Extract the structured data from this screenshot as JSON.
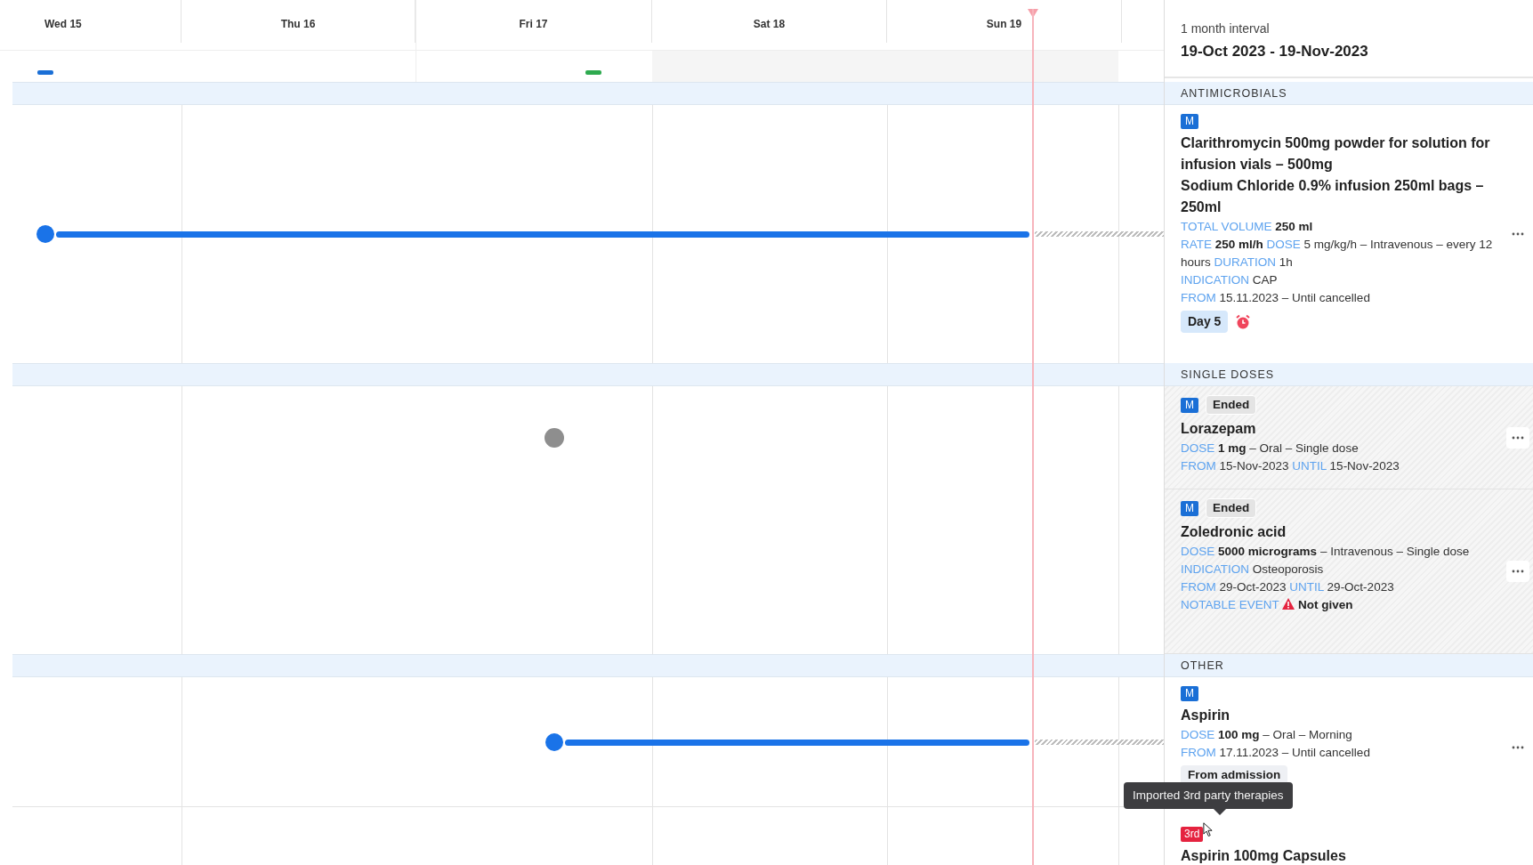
{
  "timeline": {
    "days": [
      {
        "label": "Wed 15"
      },
      {
        "label": "Thu 16"
      },
      {
        "label": "Fri 17"
      },
      {
        "label": "Sat 18"
      },
      {
        "label": "Sun 19"
      }
    ],
    "markers": [
      {
        "color": "#1a6fd6"
      },
      {
        "color": "#2eaa4f"
      }
    ],
    "rows": [
      {
        "kind": "course",
        "ongoing": true
      },
      {
        "kind": "single",
        "ongoing": false
      },
      {
        "kind": "course",
        "ongoing": true
      }
    ]
  },
  "panel": {
    "interval": "1 month interval",
    "range": "19-Oct 2023 - 19-Nov-2023",
    "sections": [
      {
        "title": "ANTIMICROBIALS",
        "items": [
          {
            "ended": false,
            "badges": [
              {
                "kind": "m",
                "text": "M"
              }
            ],
            "names": [
              "Clarithromycin 500mg powder for solution for infusion vials – 500mg",
              "Sodium Chloride 0.9% infusion 250ml bags – 250ml"
            ],
            "details": [
              [
                {
                  "kind": "label",
                  "text": "TOTAL VOLUME"
                },
                {
                  "kind": "strong",
                  "text": "250 ml"
                }
              ],
              [
                {
                  "kind": "label",
                  "text": "RATE"
                },
                {
                  "kind": "strong",
                  "text": "250 ml/h"
                },
                {
                  "kind": "label",
                  "text": "DOSE"
                },
                {
                  "kind": "text",
                  "text": "5 mg/kg/h – Intravenous – every 12 hours"
                },
                {
                  "kind": "label",
                  "text": "DURATION"
                },
                {
                  "kind": "text",
                  "text": "1h"
                }
              ],
              [
                {
                  "kind": "label",
                  "text": "INDICATION"
                },
                {
                  "kind": "text",
                  "text": "CAP"
                }
              ],
              [
                {
                  "kind": "label",
                  "text": "FROM"
                },
                {
                  "kind": "text",
                  "text": "15.11.2023 – Until cancelled"
                }
              ]
            ],
            "tags": [
              {
                "kind": "day",
                "text": "Day 5"
              },
              {
                "kind": "alarm"
              }
            ]
          }
        ]
      },
      {
        "title": "SINGLE DOSES",
        "items": [
          {
            "ended": true,
            "badges": [
              {
                "kind": "m",
                "text": "M"
              },
              {
                "kind": "status",
                "text": "Ended"
              }
            ],
            "names": [
              "Lorazepam"
            ],
            "details": [
              [
                {
                  "kind": "label",
                  "text": "DOSE"
                },
                {
                  "kind": "strong",
                  "text": "1 mg"
                },
                {
                  "kind": "text",
                  "text": "– Oral – Single dose"
                }
              ],
              [
                {
                  "kind": "label",
                  "text": "FROM"
                },
                {
                  "kind": "text",
                  "text": "15-Nov-2023"
                },
                {
                  "kind": "label",
                  "text": "UNTIL"
                },
                {
                  "kind": "text",
                  "text": "15-Nov-2023"
                }
              ]
            ]
          },
          {
            "ended": true,
            "badges": [
              {
                "kind": "m",
                "text": "M"
              },
              {
                "kind": "status",
                "text": "Ended"
              }
            ],
            "names": [
              "Zoledronic acid"
            ],
            "details": [
              [
                {
                  "kind": "label",
                  "text": "DOSE"
                },
                {
                  "kind": "strong",
                  "text": "5000 micrograms"
                },
                {
                  "kind": "text",
                  "text": "– Intravenous – Single dose"
                }
              ],
              [
                {
                  "kind": "label",
                  "text": "INDICATION"
                },
                {
                  "kind": "text",
                  "text": "Osteoporosis"
                }
              ],
              [
                {
                  "kind": "label",
                  "text": "FROM"
                },
                {
                  "kind": "text",
                  "text": "29-Oct-2023"
                },
                {
                  "kind": "label",
                  "text": "UNTIL"
                },
                {
                  "kind": "text",
                  "text": "29-Oct-2023"
                }
              ],
              [
                {
                  "kind": "label",
                  "text": "NOTABLE EVENT"
                },
                {
                  "kind": "warning"
                },
                {
                  "kind": "strong",
                  "text": "Not given"
                }
              ]
            ]
          }
        ]
      },
      {
        "title": "OTHER",
        "items": [
          {
            "ended": false,
            "badges": [
              {
                "kind": "m",
                "text": "M"
              }
            ],
            "names": [
              "Aspirin"
            ],
            "details": [
              [
                {
                  "kind": "label",
                  "text": "DOSE"
                },
                {
                  "kind": "strong",
                  "text": "100 mg"
                },
                {
                  "kind": "text",
                  "text": "– Oral – Morning"
                }
              ],
              [
                {
                  "kind": "label",
                  "text": "FROM"
                },
                {
                  "kind": "text",
                  "text": "17.11.2023 – Until cancelled"
                }
              ]
            ],
            "tags": [
              {
                "kind": "plain",
                "text": "From admission"
              }
            ]
          },
          {
            "ended": false,
            "badges": [
              {
                "kind": "third",
                "text": "3rd"
              }
            ],
            "names": [
              "Aspirin 100mg Capsules"
            ]
          }
        ]
      }
    ]
  },
  "tooltip": "Imported 3rd party therapies"
}
